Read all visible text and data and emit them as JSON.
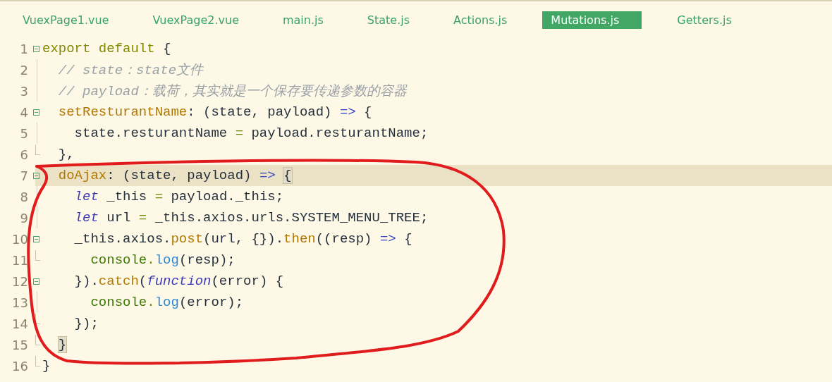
{
  "tabs": [
    {
      "label": "VuexPage1.vue",
      "selected": false
    },
    {
      "label": "VuexPage2.vue",
      "selected": false
    },
    {
      "label": "main.js",
      "selected": false
    },
    {
      "label": "State.js",
      "selected": false
    },
    {
      "label": "Actions.js",
      "selected": false
    },
    {
      "label": "Mutations.js",
      "selected": true
    },
    {
      "label": "Getters.js",
      "selected": false
    }
  ],
  "editor": {
    "lines": [
      {
        "number": "1",
        "fold_start": true,
        "fold_end": false,
        "current": false,
        "tokens": [
          {
            "kind": "keyword",
            "text": "export default"
          },
          {
            "kind": "plain",
            "text": " {"
          }
        ]
      },
      {
        "number": "2",
        "fold_start": false,
        "fold_end": false,
        "current": false,
        "tokens": [
          {
            "kind": "comment",
            "text": "  // state：state文件"
          }
        ]
      },
      {
        "number": "3",
        "fold_start": false,
        "fold_end": false,
        "current": false,
        "tokens": [
          {
            "kind": "comment",
            "text": "  // payload：载荷，其实就是一个保存要传递参数的容器"
          }
        ]
      },
      {
        "number": "4",
        "fold_start": true,
        "fold_end": false,
        "current": false,
        "tokens": [
          {
            "kind": "property",
            "text": "  setResturantName"
          },
          {
            "kind": "plain",
            "text": ": (state, payload) "
          },
          {
            "kind": "arrow",
            "text": "=>"
          },
          {
            "kind": "plain",
            "text": " {"
          }
        ]
      },
      {
        "number": "5",
        "fold_start": false,
        "fold_end": false,
        "current": false,
        "tokens": [
          {
            "kind": "plain",
            "text": "    state.resturantName "
          },
          {
            "kind": "operator",
            "text": "="
          },
          {
            "kind": "plain",
            "text": " payload.resturantName;"
          }
        ]
      },
      {
        "number": "6",
        "fold_start": false,
        "fold_end": true,
        "current": false,
        "tokens": [
          {
            "kind": "plain",
            "text": "  },"
          }
        ]
      },
      {
        "number": "7",
        "fold_start": true,
        "fold_end": false,
        "current": true,
        "tokens": [
          {
            "kind": "property",
            "text": "  doAjax"
          },
          {
            "kind": "plain",
            "text": ": (state, payload) "
          },
          {
            "kind": "arrow",
            "text": "=>"
          },
          {
            "kind": "brace",
            "text": "{"
          }
        ]
      },
      {
        "number": "8",
        "fold_start": false,
        "fold_end": false,
        "current": false,
        "tokens": [
          {
            "kind": "declare",
            "text": "    let"
          },
          {
            "kind": "plain",
            "text": " _this "
          },
          {
            "kind": "operator",
            "text": "="
          },
          {
            "kind": "plain",
            "text": " payload._this;"
          }
        ]
      },
      {
        "number": "9",
        "fold_start": false,
        "fold_end": false,
        "current": false,
        "tokens": [
          {
            "kind": "declare",
            "text": "    let"
          },
          {
            "kind": "plain",
            "text": " url "
          },
          {
            "kind": "operator",
            "text": "="
          },
          {
            "kind": "plain",
            "text": " _this.axios.urls.SYSTEM_MENU_TREE;"
          }
        ]
      },
      {
        "number": "10",
        "fold_start": true,
        "fold_end": false,
        "current": false,
        "tokens": [
          {
            "kind": "plain",
            "text": "    _this.axios."
          },
          {
            "kind": "method",
            "text": "post"
          },
          {
            "kind": "plain",
            "text": "(url, {})."
          },
          {
            "kind": "method",
            "text": "then"
          },
          {
            "kind": "plain",
            "text": "((resp) "
          },
          {
            "kind": "arrow",
            "text": "=>"
          },
          {
            "kind": "plain",
            "text": " {"
          }
        ]
      },
      {
        "number": "11",
        "fold_start": false,
        "fold_end": true,
        "current": false,
        "tokens": [
          {
            "kind": "object",
            "text": "      console"
          },
          {
            "kind": "operator",
            "text": "."
          },
          {
            "kind": "call",
            "text": "log"
          },
          {
            "kind": "plain",
            "text": "(resp);"
          }
        ]
      },
      {
        "number": "12",
        "fold_start": true,
        "fold_end": false,
        "current": false,
        "tokens": [
          {
            "kind": "plain",
            "text": "    })."
          },
          {
            "kind": "method",
            "text": "catch"
          },
          {
            "kind": "plain",
            "text": "("
          },
          {
            "kind": "declare",
            "text": "function"
          },
          {
            "kind": "plain",
            "text": "(error) {"
          }
        ]
      },
      {
        "number": "13",
        "fold_start": false,
        "fold_end": false,
        "current": false,
        "tokens": [
          {
            "kind": "object",
            "text": "      console"
          },
          {
            "kind": "operator",
            "text": "."
          },
          {
            "kind": "call",
            "text": "log"
          },
          {
            "kind": "plain",
            "text": "(error);"
          }
        ]
      },
      {
        "number": "14",
        "fold_start": false,
        "fold_end": true,
        "current": false,
        "tokens": [
          {
            "kind": "plain",
            "text": "    });"
          }
        ]
      },
      {
        "number": "15",
        "fold_start": false,
        "fold_end": true,
        "current": false,
        "tokens": [
          {
            "kind": "brace",
            "text": "  }"
          }
        ]
      },
      {
        "number": "16",
        "fold_start": false,
        "fold_end": true,
        "current": false,
        "tokens": [
          {
            "kind": "plain",
            "text": "}"
          }
        ]
      }
    ]
  }
}
